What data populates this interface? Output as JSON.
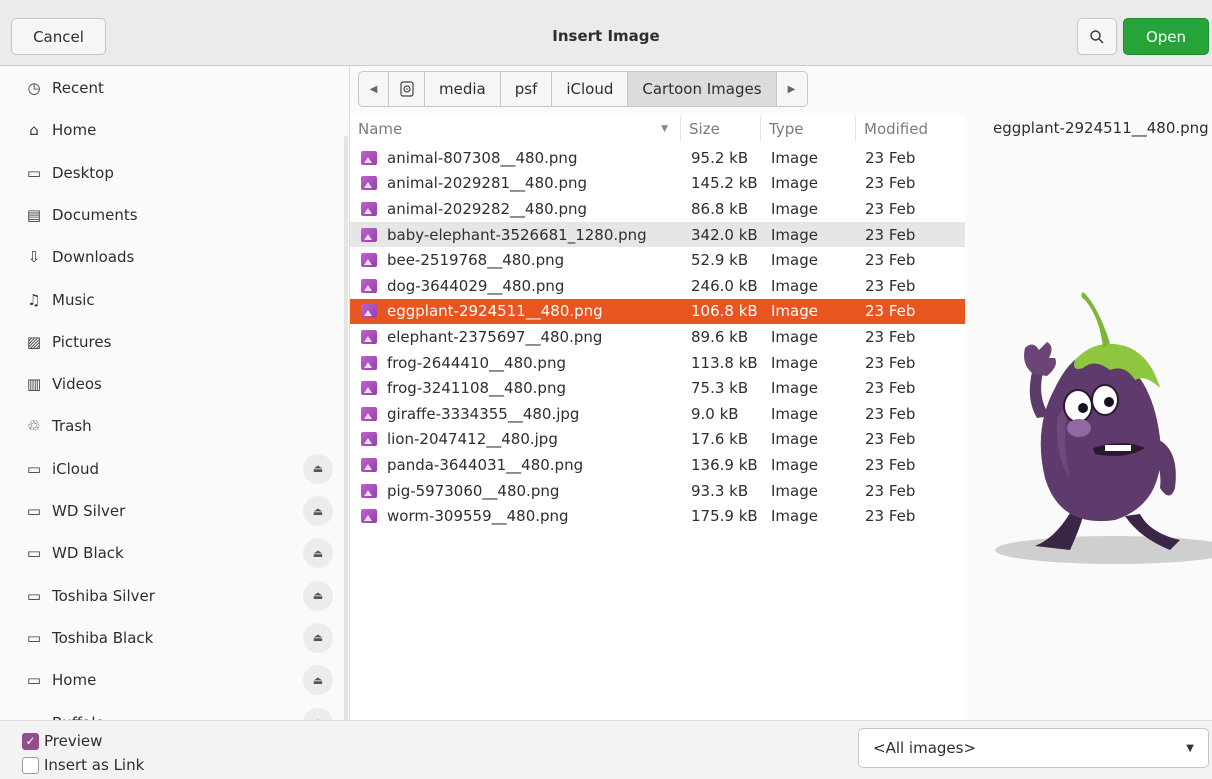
{
  "header": {
    "cancel_label": "Cancel",
    "title": "Insert Image",
    "open_label": "Open"
  },
  "sidebar": {
    "items": [
      {
        "label": "Recent",
        "icon": "clock-icon",
        "glyph": "◷",
        "eject": false
      },
      {
        "label": "Home",
        "icon": "home-icon",
        "glyph": "⌂",
        "eject": false
      },
      {
        "label": "Desktop",
        "icon": "desktop-icon",
        "glyph": "▭",
        "eject": false
      },
      {
        "label": "Documents",
        "icon": "document-icon",
        "glyph": "▤",
        "eject": false
      },
      {
        "label": "Downloads",
        "icon": "download-icon",
        "glyph": "⇩",
        "eject": false
      },
      {
        "label": "Music",
        "icon": "music-icon",
        "glyph": "♫",
        "eject": false
      },
      {
        "label": "Pictures",
        "icon": "picture-icon",
        "glyph": "▨",
        "eject": false
      },
      {
        "label": "Videos",
        "icon": "video-icon",
        "glyph": "▥",
        "eject": false
      },
      {
        "label": "Trash",
        "icon": "trash-icon",
        "glyph": "♲",
        "eject": false
      },
      {
        "label": "iCloud",
        "icon": "drive-icon",
        "glyph": "▭",
        "eject": true
      },
      {
        "label": "WD Silver",
        "icon": "drive-icon",
        "glyph": "▭",
        "eject": true
      },
      {
        "label": "WD Black",
        "icon": "drive-icon",
        "glyph": "▭",
        "eject": true
      },
      {
        "label": "Toshiba Silver",
        "icon": "drive-icon",
        "glyph": "▭",
        "eject": true
      },
      {
        "label": "Toshiba Black",
        "icon": "drive-icon",
        "glyph": "▭",
        "eject": true
      },
      {
        "label": "Home",
        "icon": "drive-icon",
        "glyph": "▭",
        "eject": true
      },
      {
        "label": "Buffalo",
        "icon": "drive-icon",
        "glyph": "▭",
        "eject": true
      }
    ]
  },
  "pathbar": {
    "crumbs": [
      "media",
      "psf",
      "iCloud",
      "Cartoon Images"
    ]
  },
  "columns": {
    "name": "Name",
    "size": "Size",
    "type": "Type",
    "modified": "Modified"
  },
  "files": [
    {
      "name": "animal-807308__480.png",
      "size": "95.2 kB",
      "type": "Image",
      "modified": "23 Feb",
      "state": ""
    },
    {
      "name": "animal-2029281__480.png",
      "size": "145.2 kB",
      "type": "Image",
      "modified": "23 Feb",
      "state": ""
    },
    {
      "name": "animal-2029282__480.png",
      "size": "86.8 kB",
      "type": "Image",
      "modified": "23 Feb",
      "state": ""
    },
    {
      "name": "baby-elephant-3526681_1280.png",
      "size": "342.0 kB",
      "type": "Image",
      "modified": "23 Feb",
      "state": "hover"
    },
    {
      "name": "bee-2519768__480.png",
      "size": "52.9 kB",
      "type": "Image",
      "modified": "23 Feb",
      "state": ""
    },
    {
      "name": "dog-3644029__480.png",
      "size": "246.0 kB",
      "type": "Image",
      "modified": "23 Feb",
      "state": ""
    },
    {
      "name": "eggplant-2924511__480.png",
      "size": "106.8 kB",
      "type": "Image",
      "modified": "23 Feb",
      "state": "selected"
    },
    {
      "name": "elephant-2375697__480.png",
      "size": "89.6 kB",
      "type": "Image",
      "modified": "23 Feb",
      "state": ""
    },
    {
      "name": "frog-2644410__480.png",
      "size": "113.8 kB",
      "type": "Image",
      "modified": "23 Feb",
      "state": ""
    },
    {
      "name": "frog-3241108__480.png",
      "size": "75.3 kB",
      "type": "Image",
      "modified": "23 Feb",
      "state": ""
    },
    {
      "name": "giraffe-3334355__480.jpg",
      "size": "9.0 kB",
      "type": "Image",
      "modified": "23 Feb",
      "state": ""
    },
    {
      "name": "lion-2047412__480.jpg",
      "size": "17.6 kB",
      "type": "Image",
      "modified": "23 Feb",
      "state": ""
    },
    {
      "name": "panda-3644031__480.png",
      "size": "136.9 kB",
      "type": "Image",
      "modified": "23 Feb",
      "state": ""
    },
    {
      "name": "pig-5973060__480.png",
      "size": "93.3 kB",
      "type": "Image",
      "modified": "23 Feb",
      "state": ""
    },
    {
      "name": "worm-309559__480.png",
      "size": "175.9 kB",
      "type": "Image",
      "modified": "23 Feb",
      "state": ""
    }
  ],
  "preview": {
    "filename": "eggplant-2924511__480.png"
  },
  "footer": {
    "preview_label": "Preview",
    "preview_checked": true,
    "link_label": "Insert as Link",
    "link_checked": false,
    "filter_value": "<All images>"
  },
  "colors": {
    "accent_selected": "#e95420",
    "open_button": "#26a439",
    "checkbox_checked": "#924d8b"
  }
}
